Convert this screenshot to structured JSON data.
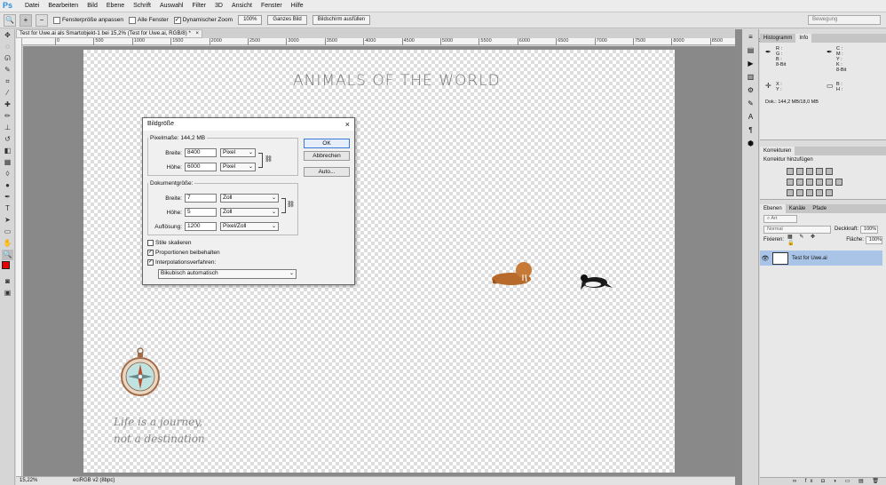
{
  "app": {
    "logo": "Ps"
  },
  "menu": [
    "Datei",
    "Bearbeiten",
    "Bild",
    "Ebene",
    "Schrift",
    "Auswahl",
    "Filter",
    "3D",
    "Ansicht",
    "Fenster",
    "Hilfe"
  ],
  "options": {
    "fit_window": "Fensterpröße anpassen",
    "all_windows": "Alle Fenster",
    "dynamic_zoom": "Dynamischer Zoom",
    "zoom_100": "100%",
    "whole_image": "Ganzes Bild",
    "fill_screen": "Bildschirm ausfüllen",
    "workspace": "Bewegung"
  },
  "document": {
    "tab_title": "Test for Uwe.ai als Smartobjekt-1 bei 15,2% (Test for Uwe.ai, RGB/8) *",
    "tab_close": "×",
    "ruler_ticks": [
      "0",
      "500",
      "1000",
      "1500",
      "2000",
      "2500",
      "3000",
      "3500",
      "4000",
      "4500",
      "5000",
      "5500",
      "6000",
      "6500",
      "7000",
      "7500",
      "8000",
      "8500",
      "9000"
    ],
    "canvas_title": "ANIMALS OF THE WORLD",
    "canvas_quote_1": "Life is a journey,",
    "canvas_quote_2": "not a destination"
  },
  "status": {
    "zoom": "15,22%",
    "profile": "eciRGB v2 (8bpc)"
  },
  "panels": {
    "info_tabs": [
      "Histogramm",
      "Info"
    ],
    "info_r": "R :",
    "info_g": "G :",
    "info_b": "B :",
    "info_bit1": "8-Bit",
    "info_c": "C :",
    "info_m": "M :",
    "info_y": "Y :",
    "info_k": "K :",
    "info_bit2": "8-Bit",
    "info_x": "X :",
    "info_yy": "Y :",
    "info_w": "B :",
    "info_h": "H :",
    "info_doc": "Dok.: 144,2 MB/18,0 MB",
    "adj_tab": "Korrekturen",
    "adj_title": "Korrektur hinzufügen",
    "layer_tabs": [
      "Ebenen",
      "Kanäle",
      "Pfade"
    ],
    "layer_filter": "Art",
    "blend_mode": "Normal",
    "opacity_label": "Deckkraft:",
    "opacity": "100%",
    "lock_label": "Fixieren:",
    "fill_label": "Fläche:",
    "fill": "100%",
    "layer_name": "Test for Uwe.ai",
    "layer_footer": "∞ fx ◘ ◑ ▭ ▤ 🗑"
  },
  "dialog": {
    "title": "Bildgröße",
    "close": "×",
    "pixel_legend": "Pixelmaße: 144,2 MB",
    "width_label": "Breite:",
    "width_value": "8400",
    "width_unit": "Pixel",
    "height_label": "Höhe:",
    "height_value": "6000",
    "height_unit": "Pixel",
    "doc_legend": "Dokumentgröße:",
    "doc_width_label": "Breite:",
    "doc_width_value": "7",
    "doc_width_unit": "Zoll",
    "doc_height_label": "Höhe:",
    "doc_height_value": "5",
    "doc_height_unit": "Zoll",
    "res_label": "Auflösung:",
    "res_value": "1200",
    "res_unit": "Pixel/Zoll",
    "scale_styles": "Stile skalieren",
    "constrain": "Proportionen beibehalten",
    "resample": "Interpolationsverfahren:",
    "resample_method": "Bikubisch automatisch",
    "ok": "OK",
    "cancel": "Abbrechen",
    "auto": "Auto...",
    "checks": {
      "scale_styles": false,
      "constrain": true,
      "resample": true
    }
  }
}
